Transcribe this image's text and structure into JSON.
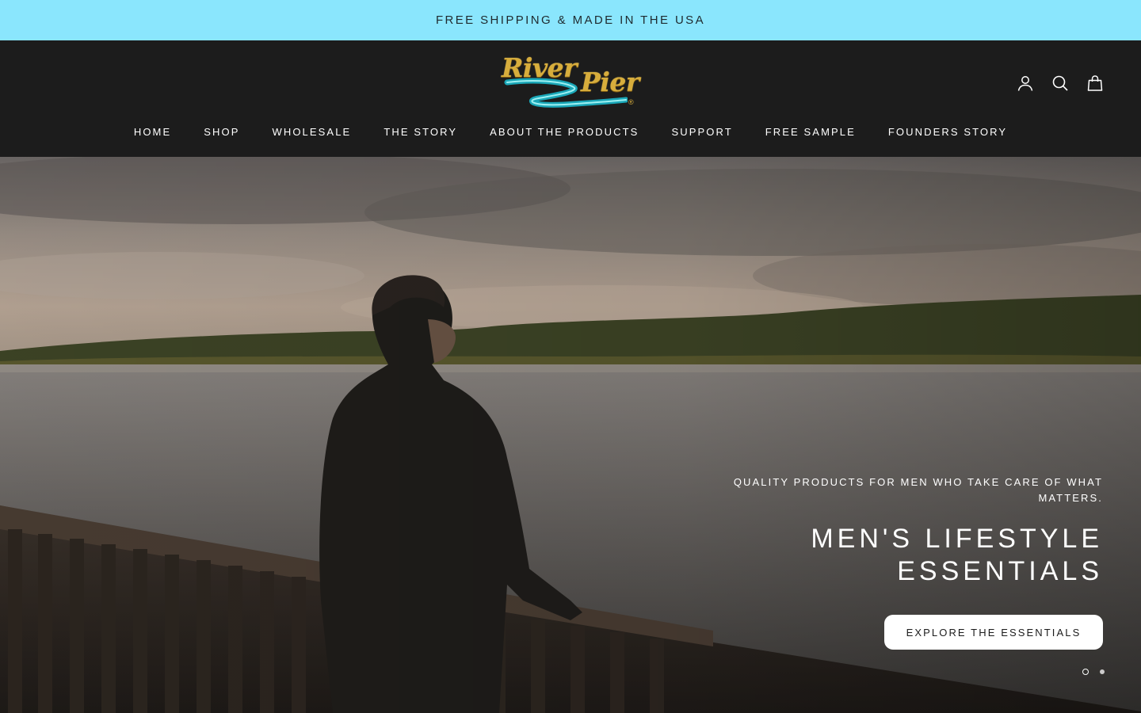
{
  "announcement": {
    "text": "FREE SHIPPING & MADE IN THE USA",
    "bg_color": "#8ae6fd"
  },
  "header": {
    "logo": {
      "word1": "River",
      "word2": "Pier",
      "reg_mark": "®"
    },
    "icons": [
      "account-icon",
      "search-icon",
      "cart-icon"
    ],
    "bg_color": "#1c1c1c"
  },
  "nav": {
    "items": [
      {
        "label": "HOME"
      },
      {
        "label": "SHOP"
      },
      {
        "label": "WHOLESALE"
      },
      {
        "label": "THE STORY"
      },
      {
        "label": "ABOUT THE PRODUCTS"
      },
      {
        "label": "SUPPORT"
      },
      {
        "label": "FREE SAMPLE"
      },
      {
        "label": "FOUNDERS STORY"
      }
    ]
  },
  "hero": {
    "subtitle": "QUALITY PRODUCTS FOR MEN WHO TAKE CARE OF WHAT MATTERS.",
    "title": "MEN'S LIFESTYLE ESSENTIALS",
    "cta_label": "EXPLORE THE ESSENTIALS",
    "slides_total": 2,
    "active_slide": 1
  }
}
